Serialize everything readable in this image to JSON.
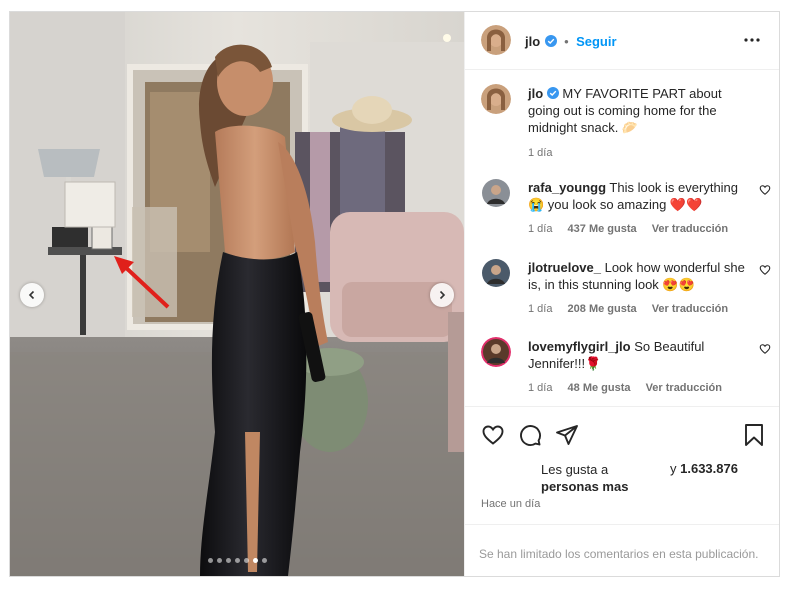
{
  "post": {
    "username": "jlo",
    "follow_label": "Seguir",
    "caption": "MY FAVORITE PART about going out is coming home for the midnight snack. 🥟",
    "caption_time": "1 día",
    "image_dots": 7,
    "active_dot_index": 5
  },
  "comments": [
    {
      "username": "rafa_youngg",
      "text": "This look is everything 😭 you look so amazing ❤️❤️",
      "time": "1 día",
      "likes": "437 Me gusta",
      "translate": "Ver traducción"
    },
    {
      "username": "jlotruelove_",
      "text": "Look how wonderful she is, in this stunning look 😍😍",
      "time": "1 día",
      "likes": "208 Me gusta",
      "translate": "Ver traducción"
    },
    {
      "username": "lovemyflygirl_jlo",
      "text": "So Beautiful Jennifer!!!🌹",
      "time": "1 día",
      "likes": "48 Me gusta",
      "translate": "Ver traducción"
    }
  ],
  "likes": {
    "line1": "Les gusta a",
    "line2": "personas mas",
    "count_text": "y 1.633.876"
  },
  "timestamp": "Hace un día",
  "comments_limited": "Se han limitado los comentarios en esta publicación.",
  "colors": {
    "accent": "#0095f6",
    "verified": "#3897f0",
    "text": "#262626",
    "muted": "#737373",
    "annotation_arrow": "#e0201b"
  }
}
